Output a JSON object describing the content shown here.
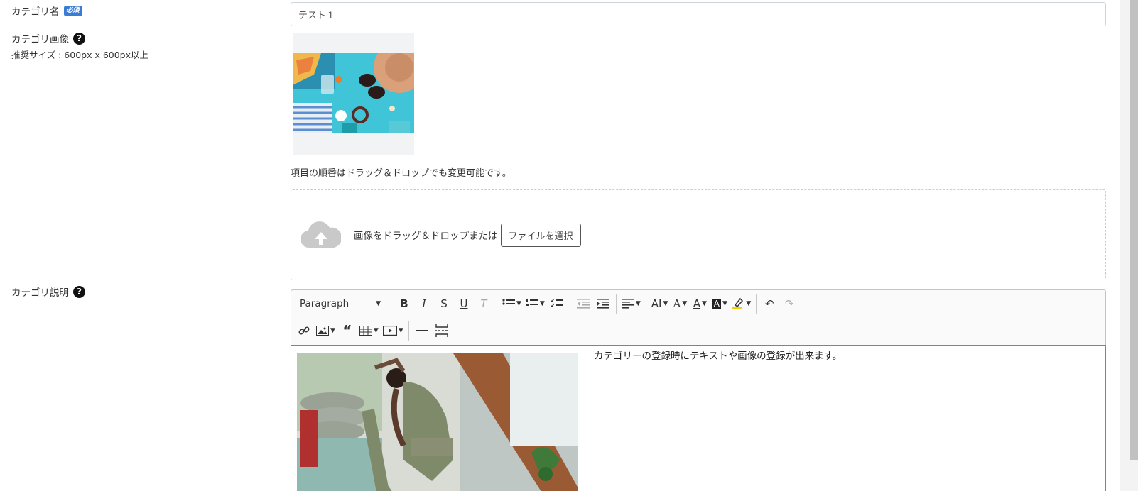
{
  "category_name": {
    "label": "カテゴリ名",
    "required_badge": "必須",
    "value": "テスト１"
  },
  "category_image": {
    "label": "カテゴリ画像",
    "recommended_size": "推奨サイズ : 600px x 600px以上",
    "thumbnail_alt": "beach items flat lay"
  },
  "order_note": "項目の順番はドラッグ＆ドロップでも変更可能です。",
  "dropzone": {
    "text": "画像をドラッグ＆ドロップまたは",
    "button": "ファイルを選択"
  },
  "category_description": {
    "label": "カテゴリ説明",
    "paragraph_select": "Paragraph",
    "editor_text": "カテゴリーの登録時にテキストや画像の登録が出来ます。"
  },
  "icons": {
    "help": "?",
    "bold": "B",
    "italic": "I",
    "strike": "S",
    "underline": "U",
    "clear": "T",
    "font_size": "AI",
    "font_color": "A"
  },
  "colors": {
    "badge": "#3a7bd5",
    "editor_focus": "#2f9ed6"
  }
}
